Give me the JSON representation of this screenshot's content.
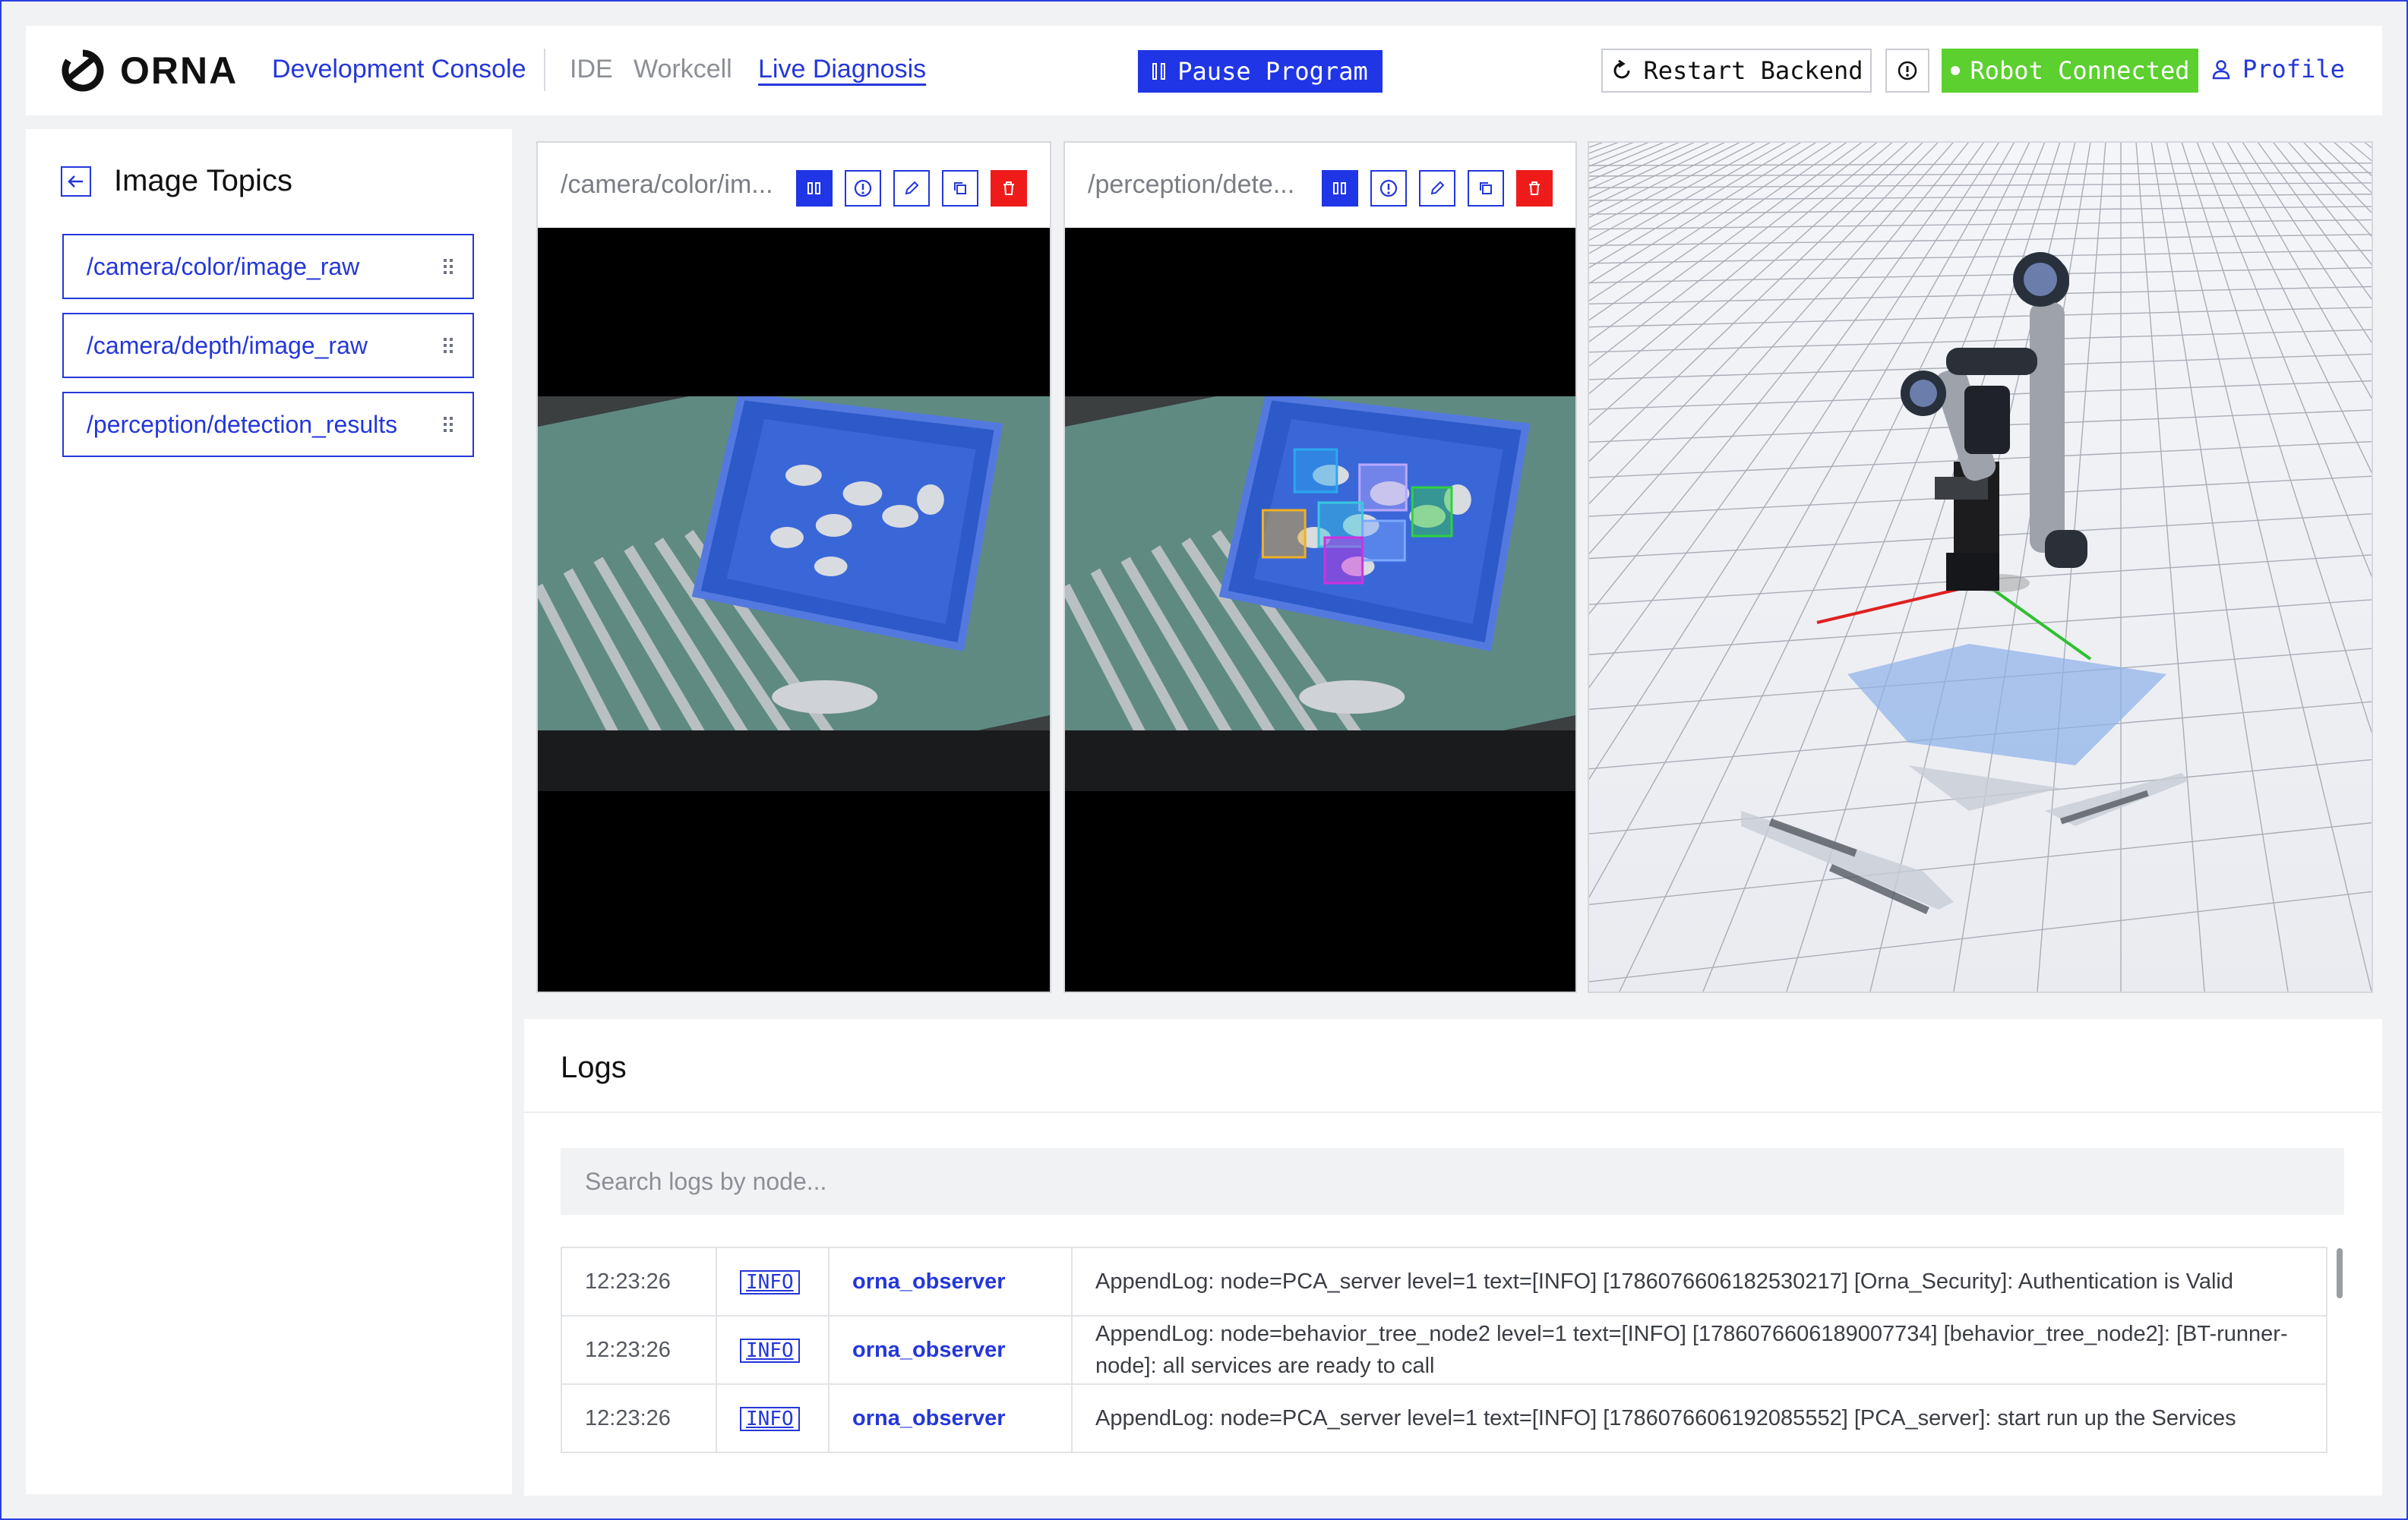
{
  "header": {
    "brand": "ORNA",
    "nav": {
      "console": "Development Console",
      "ide": "IDE",
      "workcell": "Workcell",
      "live": "Live Diagnosis"
    },
    "pause_label": "Pause Program",
    "restart_label": "Restart Backend",
    "connection_status": "Robot Connected",
    "profile_label": "Profile"
  },
  "sidebar": {
    "title": "Image Topics",
    "topics": [
      "/camera/color/image_raw",
      "/camera/depth/image_raw",
      "/perception/detection_results"
    ]
  },
  "panels": [
    {
      "title": "/camera/color/im..."
    },
    {
      "title": "/perception/dete..."
    }
  ],
  "logs": {
    "title": "Logs",
    "search_placeholder": "Search logs by node...",
    "rows": [
      {
        "time": "12:23:26",
        "level": "INFO",
        "node": "orna_observer",
        "message": "AppendLog: node=PCA_server level=1 text=[INFO] [1786076606182530217] [Orna_Security]: Authentication is Valid"
      },
      {
        "time": "12:23:26",
        "level": "INFO",
        "node": "orna_observer",
        "message": "AppendLog: node=behavior_tree_node2 level=1 text=[INFO] [1786076606189007734] [behavior_tree_node2]: [BT-runner-node]: all services are ready to call"
      },
      {
        "time": "12:23:26",
        "level": "INFO",
        "node": "orna_observer",
        "message": "AppendLog: node=PCA_server level=1 text=[INFO] [1786076606192085552] [PCA_server]: start run up the Services"
      }
    ]
  },
  "colors": {
    "accent": "#1f35e6",
    "connected": "#5bd02f",
    "danger": "#ef1b1b"
  },
  "icons": [
    "logo-icon",
    "pause-icon",
    "restart-icon",
    "info-icon",
    "user-icon",
    "back-arrow-icon",
    "drag-handle-icon",
    "edit-icon",
    "copy-icon",
    "trash-icon"
  ]
}
